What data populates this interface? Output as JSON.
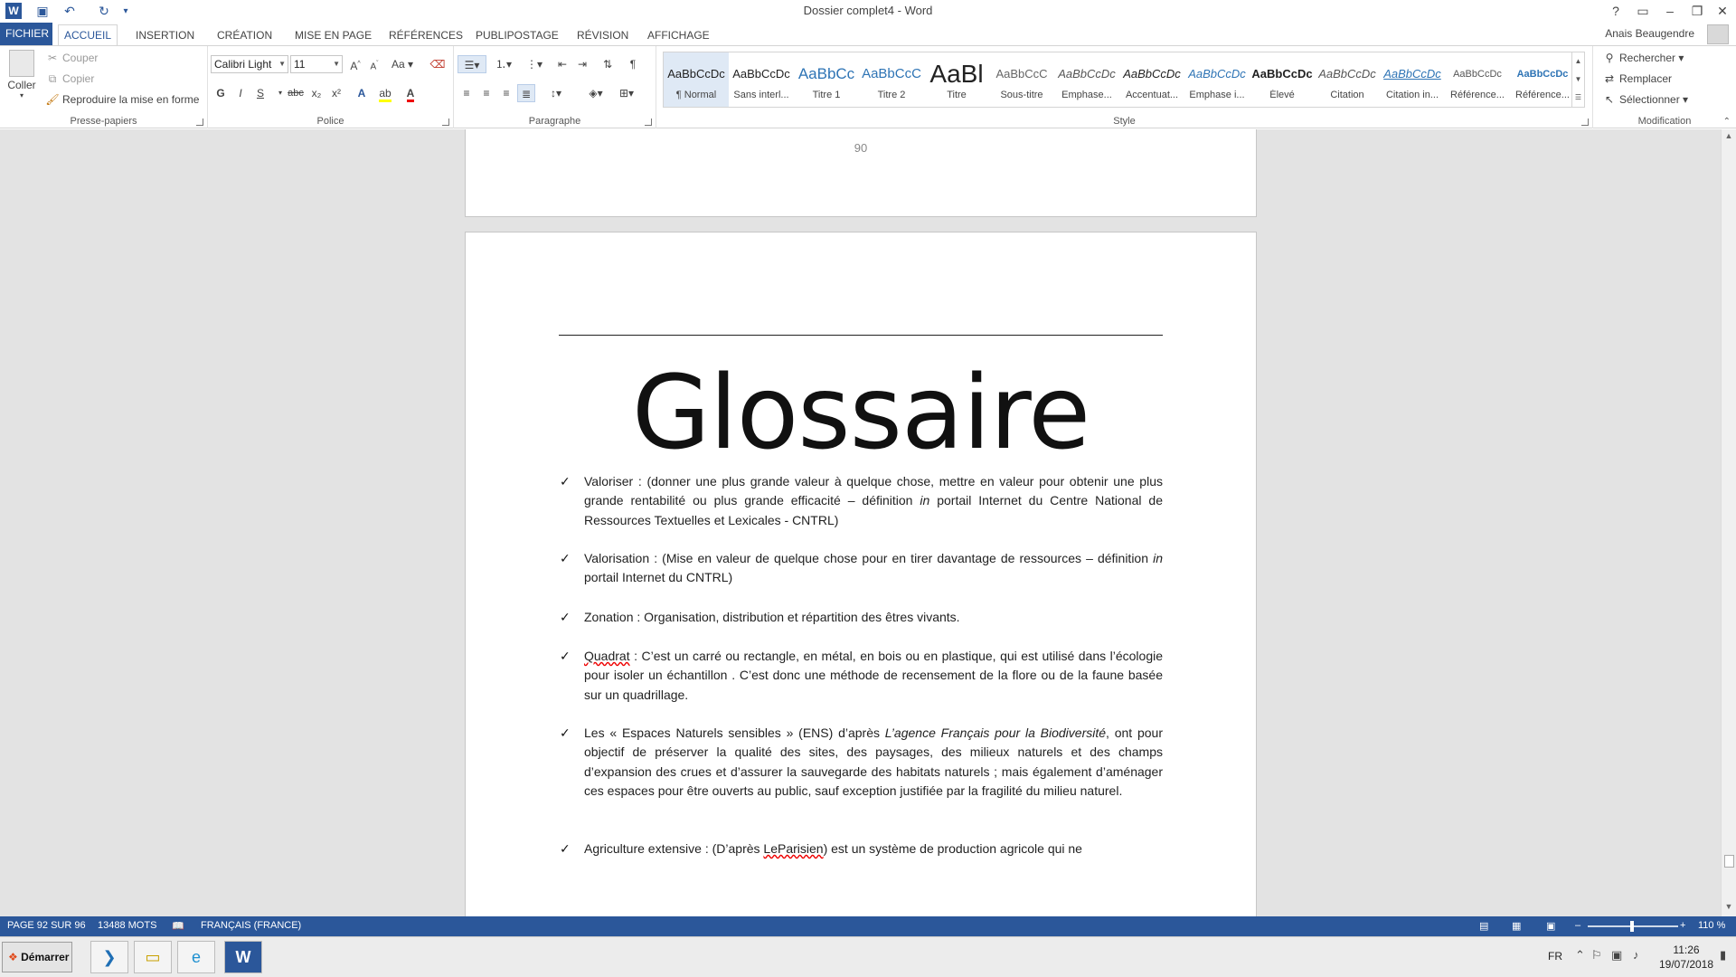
{
  "titlebar": {
    "title": "Dossier complet4 - Word",
    "help": "?",
    "ribbon_display": "▭",
    "minimize": "–",
    "restore": "❐",
    "close": "✕"
  },
  "tabs": {
    "items": [
      "FICHIER",
      "ACCUEIL",
      "INSERTION",
      "CRÉATION",
      "MISE EN PAGE",
      "RÉFÉRENCES",
      "PUBLIPOSTAGE",
      "RÉVISION",
      "AFFICHAGE"
    ],
    "active": "ACCUEIL",
    "user": "Anais Beaugendre"
  },
  "ribbon": {
    "clipboard": {
      "group_label": "Presse-papiers",
      "paste": "Coller",
      "cut": "Couper",
      "copy": "Copier",
      "format_painter": "Reproduire la mise en forme"
    },
    "font": {
      "group_label": "Police",
      "font_name": "Calibri Light",
      "font_size": "11",
      "change_case": "Aa",
      "bold": "G",
      "italic": "I",
      "underline": "S",
      "strikethrough": "abc",
      "subscript": "x₂",
      "superscript": "x²"
    },
    "paragraph": {
      "group_label": "Paragraphe"
    },
    "styles": {
      "group_label": "Style",
      "items": [
        {
          "sample": "AaBbCcDc",
          "label": "¶ Normal"
        },
        {
          "sample": "AaBbCcDc",
          "label": "Sans interl..."
        },
        {
          "sample": "AaBbCc",
          "label": "Titre 1"
        },
        {
          "sample": "AaBbCcC",
          "label": "Titre 2"
        },
        {
          "sample": "AaBl",
          "label": "Titre"
        },
        {
          "sample": "AaBbCcC",
          "label": "Sous-titre"
        },
        {
          "sample": "AaBbCcDc",
          "label": "Emphase..."
        },
        {
          "sample": "AaBbCcDc",
          "label": "Accentuat..."
        },
        {
          "sample": "AaBbCcDc",
          "label": "Emphase i..."
        },
        {
          "sample": "AaBbCcDc",
          "label": "Élevé"
        },
        {
          "sample": "AaBbCcDc",
          "label": "Citation"
        },
        {
          "sample": "AaBbCcDc",
          "label": "Citation in..."
        },
        {
          "sample": "AaBbCcDc",
          "label": "Référence..."
        },
        {
          "sample": "AaBbCcDc",
          "label": "Référence..."
        }
      ]
    },
    "editing": {
      "group_label": "Modification",
      "find": "Rechercher",
      "replace": "Remplacer",
      "select": "Sélectionner"
    }
  },
  "document": {
    "prev_page_number": "90",
    "title": "Glossaire",
    "entries": [
      {
        "id": "valoriser",
        "parts": [
          {
            "t": "Valoriser : (donner une plus grande valeur à quelque chose, mettre en valeur pour obtenir une plus grande rentabilité ou plus grande efficacité – définition "
          },
          {
            "t": "in",
            "i": true
          },
          {
            "t": " portail Internet du Centre National de Ressources Textuelles et Lexicales - CNTRL)"
          }
        ]
      },
      {
        "id": "valorisation",
        "parts": [
          {
            "t": "Valorisation : (Mise en valeur de quelque chose pour en tirer davantage de ressources – définition "
          },
          {
            "t": "in",
            "i": true
          },
          {
            "t": " portail Internet du CNTRL)"
          }
        ]
      },
      {
        "id": "zonation",
        "parts": [
          {
            "t": "Zonation : Organisation, distribution et répartition des êtres vivants."
          }
        ]
      },
      {
        "id": "quadrat",
        "parts": [
          {
            "t": "Quadrat",
            "s": true
          },
          {
            "t": " : C’est un carré ou rectangle, en métal, en bois ou en plastique, qui est utilisé dans l’écologie pour isoler un échantillon . C’est donc une méthode de recensement de la flore ou de la faune basée sur un quadrillage."
          }
        ]
      },
      {
        "id": "ens",
        "parts": [
          {
            "t": "Les « Espaces Naturels sensibles » (ENS) d’après "
          },
          {
            "t": "L’agence Français pour la Biodiversité",
            "i": true
          },
          {
            "t": ", ont pour objectif de préserver la qualité des sites, des paysages, des milieux naturels et des champs d’expansion des crues et d’assurer la sauvegarde des habitats naturels ; mais également d’aménager ces espaces pour être ouverts au public, sauf exception justifiée par la fragilité du milieu naturel."
          }
        ]
      },
      {
        "id": "agriculture",
        "parts": [
          {
            "t": " Agriculture extensive : (D’après "
          },
          {
            "t": "LeParisien",
            "s": true
          },
          {
            "t": ") est un système de production agricole qui ne"
          }
        ]
      }
    ]
  },
  "statusbar": {
    "page": "PAGE 92 SUR 96",
    "words": "13488 MOTS",
    "language": "FRANÇAIS (FRANCE)",
    "zoom": "110 %"
  },
  "taskbar": {
    "start": "Démarrer",
    "lang": "FR",
    "time": "11:26",
    "date": "19/07/2018"
  },
  "colors": {
    "accent": "#2b579a",
    "spellcheck": "#e00000"
  }
}
